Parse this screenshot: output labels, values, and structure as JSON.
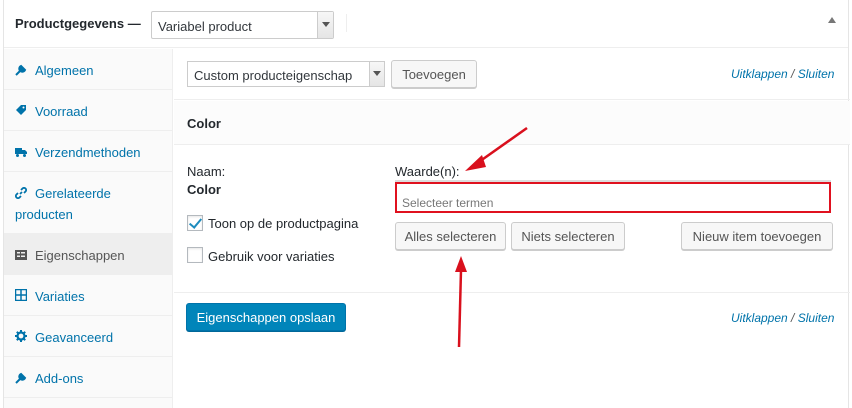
{
  "header": {
    "title": "Productgegevens —",
    "product_type": "Variabel product"
  },
  "sidebar": {
    "items": [
      {
        "label": "Algemeen",
        "icon": "wrench-icon"
      },
      {
        "label": "Voorraad",
        "icon": "tag-icon"
      },
      {
        "label": "Verzendmethoden",
        "icon": "truck-icon"
      },
      {
        "label_line1": "Gerelateerde",
        "label_line2": "producten",
        "icon": "link-icon"
      },
      {
        "label": "Eigenschappen",
        "icon": "list-icon"
      },
      {
        "label": "Variaties",
        "icon": "grid-icon"
      },
      {
        "label": "Geavanceerd",
        "icon": "gear-icon"
      },
      {
        "label": "Add-ons",
        "icon": "wrench-icon"
      }
    ]
  },
  "toolbar": {
    "attribute_select": "Custom producteigenschap",
    "add_button": "Toevoegen",
    "expand_link": "Uitklappen",
    "separator": "/",
    "close_link": "Sluiten"
  },
  "attribute": {
    "heading": "Color",
    "name_label": "Naam:",
    "name_value": "Color",
    "visible_label": "Toon op de productpagina",
    "visible_checked": true,
    "variation_label": "Gebruik voor variaties",
    "variation_checked": false,
    "value_label": "Waarde(n):",
    "value_placeholder": "Selecteer termen",
    "select_all": "Alles selecteren",
    "select_none": "Niets selecteren",
    "add_new": "Nieuw item toevoegen"
  },
  "footer": {
    "save_button": "Eigenschappen opslaan",
    "expand_link": "Uitklappen",
    "separator": "/",
    "close_link": "Sluiten"
  },
  "colors": {
    "accent": "#0073aa",
    "primary_button": "#0085ba",
    "highlight": "#e0111f"
  }
}
